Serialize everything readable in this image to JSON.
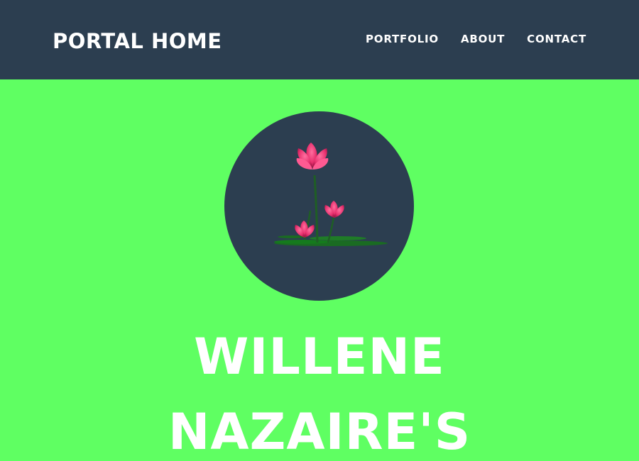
{
  "navbar": {
    "brand": "PORTAL HOME",
    "links": [
      {
        "label": "PORTFOLIO"
      },
      {
        "label": "ABOUT"
      },
      {
        "label": "CONTACT"
      }
    ]
  },
  "hero": {
    "avatar_icon": "lotus-flower-icon",
    "title_line_1": "WILLENE",
    "title_line_2": "NAZAIRE'S"
  },
  "colors": {
    "navbar_bg": "#2c3e50",
    "page_bg": "#5fff62",
    "avatar_bg": "#2c3e50",
    "text": "#ffffff",
    "flower_pink": "#e8306e",
    "leaf_green": "#1a6b22"
  }
}
